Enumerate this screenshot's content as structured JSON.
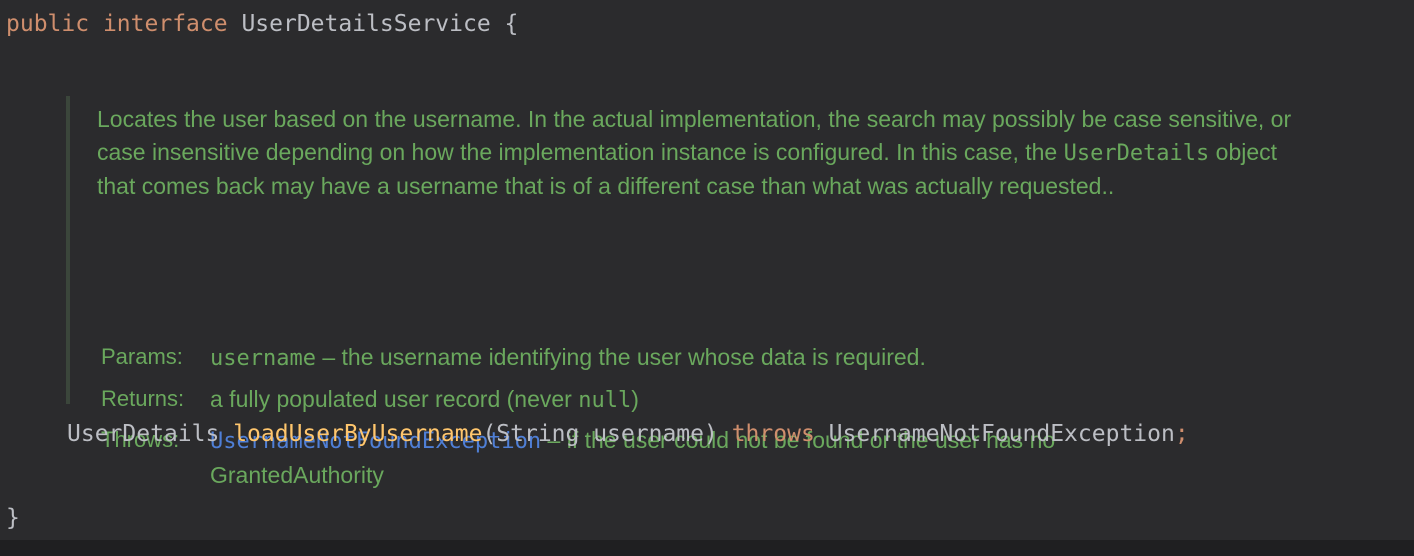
{
  "declaration": {
    "public_kw": "public",
    "interface_kw": "interface",
    "name": "UserDetailsService",
    "open_brace": "{"
  },
  "doc": {
    "description_part1": "Locates the user based on the username. In the actual implementation, the search may possibly be case sensitive, or case insensitive depending on how the implementation instance is configured. In this case, the ",
    "description_code": "UserDetails",
    "description_part2": " object that comes back may have a username that is of a different case than what was actually requested..",
    "params_label": "Params:",
    "params_code": "username",
    "params_text": " – the username identifying the user whose data is required.",
    "returns_label": "Returns:",
    "returns_text": "a fully populated user record (never ",
    "returns_code": "null",
    "returns_end": ")",
    "throws_label": "Throws:",
    "throws_link": "UsernameNotFoundException",
    "throws_text": " – if the user could not be found or the user has no GrantedAuthority"
  },
  "method": {
    "return_type": "UserDetails",
    "name": "loadUserByUsername",
    "params": "(String username)",
    "throws_kw": "throws",
    "exception": "UsernameNotFoundException",
    "semicolon": ";"
  },
  "close_brace": "}",
  "colors": {
    "background": "#2b2b2d",
    "keyword": "#cf8e6d",
    "method": "#ffc66d",
    "doc_text": "#6aa85d",
    "doc_link": "#4f7fd6",
    "plain": "#bcbec4"
  }
}
